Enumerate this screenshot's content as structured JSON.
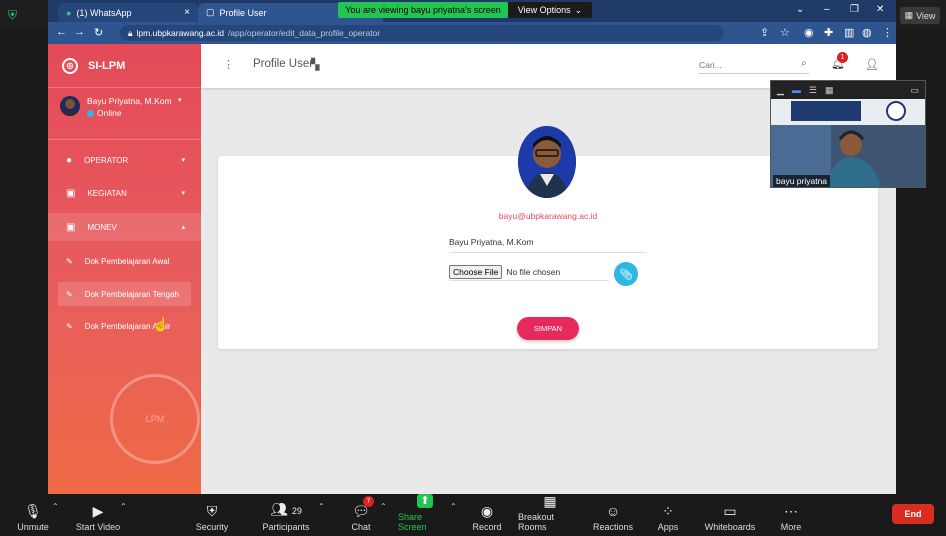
{
  "zoom": {
    "view_label": "View",
    "banner": "You are viewing bayu priyatna's screen",
    "view_options": "View Options",
    "toolbar": {
      "unmute": "Unmute",
      "start_video": "Start Video",
      "security": "Security",
      "participants": "Participants",
      "participants_count": "29",
      "chat": "Chat",
      "chat_badge": "7",
      "share_screen": "Share Screen",
      "record": "Record",
      "breakout": "Breakout Rooms",
      "reactions": "Reactions",
      "apps": "Apps",
      "whiteboards": "Whiteboards",
      "more": "More",
      "end": "End"
    },
    "video_name": "bayu priyatna",
    "colors": {
      "share_green": "#23c552",
      "end_red": "#d92d20"
    }
  },
  "browser": {
    "tabs": [
      {
        "label": "(1) WhatsApp"
      },
      {
        "label": "Profile User"
      }
    ],
    "url_host": "lpm.ubpkarawang.ac.id",
    "url_path": "/app/operator/edit_data_profile_operator"
  },
  "app": {
    "brand": "SI-LPM",
    "user_name": "Bayu Priyatna, M.Kom",
    "user_status": "Online",
    "menu": [
      {
        "label": "OPERATOR"
      },
      {
        "label": "KEGIATAN"
      },
      {
        "label": "MONEV"
      }
    ],
    "submenu": [
      {
        "label": "Dok Pembelajaran Awal"
      },
      {
        "label": "Dok Pembelajaran Tengah"
      },
      {
        "label": "Dok Pembelajaran Akhir"
      }
    ],
    "watermark": "LPM",
    "page_title": "Profile User",
    "search_placeholder": "Cari...",
    "notif_count": "1",
    "email": "bayu@ubpkarawang.ac.id",
    "name_value": "Bayu Priyatna, M.Kom",
    "choose_file": "Choose File",
    "no_file": "No file chosen",
    "save": "SIMPAN",
    "colors": {
      "accent": "#e84a5f",
      "save": "#e8295c",
      "clip": "#2fb7e4"
    }
  }
}
